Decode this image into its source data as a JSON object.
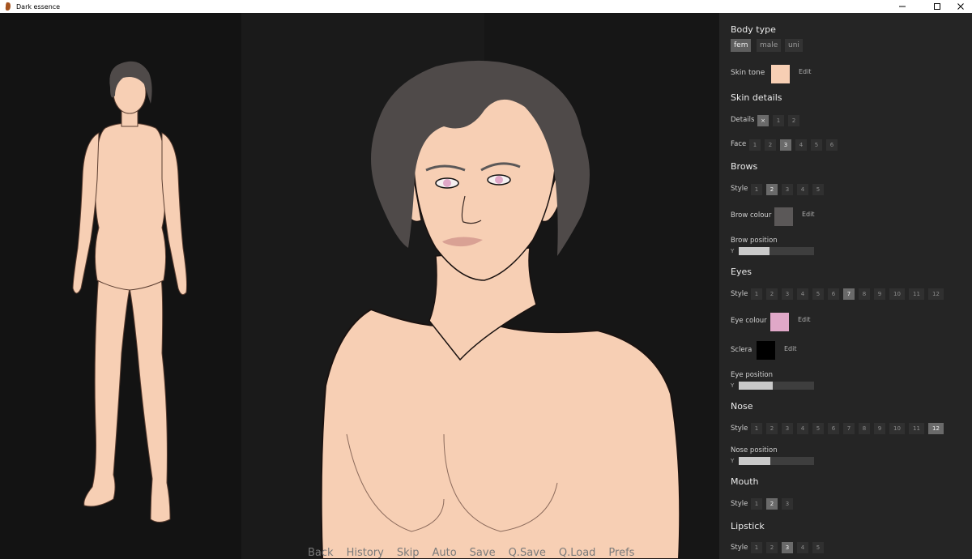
{
  "window": {
    "title": "Dark essence"
  },
  "quick_menu": [
    "Back",
    "History",
    "Skip",
    "Auto",
    "Save",
    "Q.Save",
    "Q.Load",
    "Prefs"
  ],
  "colors": {
    "skin": "#f7cfb4",
    "brow": "#5b5858",
    "eye": "#e0a8c8",
    "sclera": "#000000",
    "hair": "#4f4a49"
  },
  "sidebar": {
    "body_type": {
      "title": "Body type",
      "options": [
        "fem",
        "male",
        "uni"
      ],
      "selected": "fem"
    },
    "skin_tone": {
      "label": "Skin tone",
      "edit": "Edit",
      "color": "#f7cfb4"
    },
    "skin_details": {
      "title": "Skin details",
      "details": {
        "label": "Details",
        "options": [
          "×",
          "1",
          "2"
        ],
        "selected": "×"
      },
      "face": {
        "label": "Face",
        "options": [
          "1",
          "2",
          "3",
          "4",
          "5",
          "6"
        ],
        "selected": "3"
      }
    },
    "brows": {
      "title": "Brows",
      "style": {
        "label": "Style",
        "options": [
          "1",
          "2",
          "3",
          "4",
          "5"
        ],
        "selected": "2"
      },
      "colour": {
        "label": "Brow colour",
        "edit": "Edit",
        "color": "#5b5858"
      },
      "position": {
        "label": "Brow position",
        "axis": "Y",
        "value": 0.41
      }
    },
    "eyes": {
      "title": "Eyes",
      "style": {
        "label": "Style",
        "options": [
          "1",
          "2",
          "3",
          "4",
          "5",
          "6",
          "7",
          "8",
          "9",
          "10",
          "11",
          "12"
        ],
        "selected": "7"
      },
      "colour": {
        "label": "Eye colour",
        "edit": "Edit",
        "color": "#e0a8c8"
      },
      "sclera": {
        "label": "Sclera",
        "edit": "Edit",
        "color": "#000000"
      },
      "position": {
        "label": "Eye position",
        "axis": "Y",
        "value": 0.45
      }
    },
    "nose": {
      "title": "Nose",
      "style": {
        "label": "Style",
        "options": [
          "1",
          "2",
          "3",
          "4",
          "5",
          "6",
          "7",
          "8",
          "9",
          "10",
          "11",
          "12"
        ],
        "selected": "12"
      },
      "position": {
        "label": "Nose position",
        "axis": "Y",
        "value": 0.42
      }
    },
    "mouth": {
      "title": "Mouth",
      "style": {
        "label": "Style",
        "options": [
          "1",
          "2",
          "3"
        ],
        "selected": "2"
      }
    },
    "lipstick": {
      "title": "Lipstick",
      "style": {
        "label": "Style",
        "options": [
          "1",
          "2",
          "3",
          "4",
          "5"
        ],
        "selected": "3"
      }
    }
  }
}
